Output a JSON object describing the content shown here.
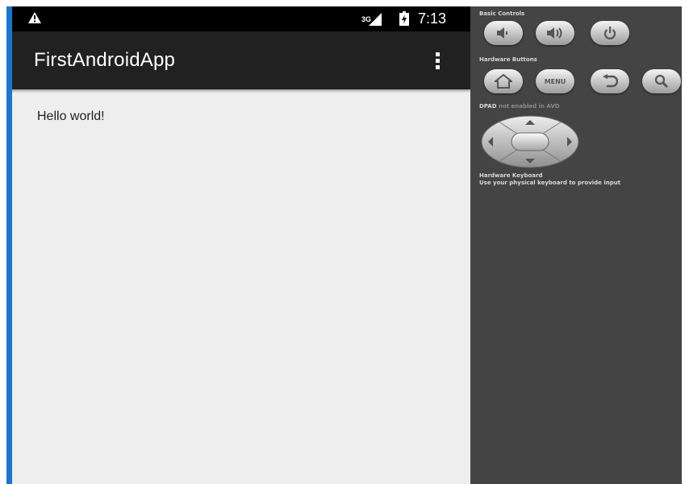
{
  "status_bar": {
    "network": "3G",
    "time": "7:13",
    "icons": [
      "warning-icon",
      "signal-icon",
      "battery-icon"
    ]
  },
  "action_bar": {
    "title": "FirstAndroidApp",
    "overflow_icon": "overflow-menu-icon"
  },
  "content": {
    "text": "Hello world!"
  },
  "emulator_controls": {
    "basic_controls": {
      "label": "Basic Controls",
      "buttons": [
        "volume-down-icon",
        "volume-up-icon",
        "power-icon"
      ]
    },
    "hardware_buttons": {
      "label": "Hardware Buttons",
      "buttons": [
        "home-icon",
        "menu-button",
        "back-icon",
        "search-icon"
      ],
      "menu_label": "MENU"
    },
    "dpad": {
      "label_part1": "DPAD",
      "label_part2": "not enabled in AVD"
    },
    "hardware_keyboard": {
      "label": "Hardware Keyboard",
      "description": "Use your physical keyboard to provide input"
    }
  },
  "colors": {
    "status_bar": "#000000",
    "action_bar": "#212121",
    "screen_background": "#eeeeee",
    "controls_panel": "#444444",
    "edge_accent": "#1976d2"
  }
}
